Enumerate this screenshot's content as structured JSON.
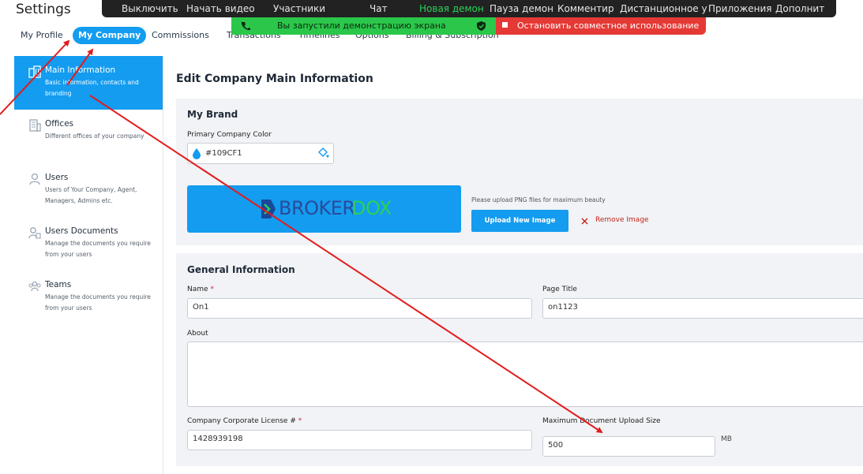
{
  "header": {
    "title": "Settings"
  },
  "tabs": [
    {
      "label": "My Profile"
    },
    {
      "label": "My Company"
    },
    {
      "label": "Commissions"
    },
    {
      "label": "Transactions"
    },
    {
      "label": "Timelines"
    },
    {
      "label": "Options"
    },
    {
      "label": "Billing & Subscription"
    }
  ],
  "sidebar": {
    "items": [
      {
        "title": "Main Information",
        "desc": "Basic information, contacts and branding",
        "icon": "building-icon"
      },
      {
        "title": "Offices",
        "desc": "Different offices of your company",
        "icon": "office-icon"
      },
      {
        "title": "Users",
        "desc": "Users of Your Company, Agent, Managers, Admins etc.",
        "icon": "user-icon"
      },
      {
        "title": "Users Documents",
        "desc": "Manage the documents you require from your users",
        "icon": "user-document-icon"
      },
      {
        "title": "Teams",
        "desc": "Manage the documents you require from your users",
        "icon": "teams-icon"
      }
    ]
  },
  "main": {
    "heading": "Edit Company Main Information",
    "brand": {
      "title": "My Brand",
      "color_label": "Primary Company Color",
      "color_value": "#109CF1",
      "logo_text_a": "BROKER",
      "logo_text_b": "DOX",
      "upload_hint": "Please upload PNG files for maximum beauty",
      "upload_label": "Upload New Image",
      "remove_label": "Remove Image"
    },
    "general": {
      "title": "General Information",
      "name_label": "Name",
      "name_value": "On1",
      "page_title_label": "Page Title",
      "page_title_value": "on1123",
      "about_label": "About",
      "about_value": "",
      "license_label": "Company Corporate License #",
      "license_value": "1428939198",
      "max_upload_label": "Maximum Document Upload Size",
      "max_upload_value": "500",
      "max_upload_unit": "MB"
    },
    "required_mark": "*"
  },
  "zoom_toolbar": {
    "items": [
      {
        "label": "Выключить"
      },
      {
        "label": "Начать видео"
      },
      {
        "label": "Участники"
      },
      {
        "label": "Чат"
      },
      {
        "label": "Новая демон"
      },
      {
        "label": "Пауза демон"
      },
      {
        "label": "Комментир"
      },
      {
        "label": "Дистанционное у"
      },
      {
        "label": "Приложения"
      },
      {
        "label": "Дополнит"
      }
    ],
    "sharing_text": "Вы запустили демонстрацию экрана",
    "stop_text": "Остановить совместное использование"
  },
  "colors": {
    "accent": "#139cf0",
    "primary_brand": "#109CF1",
    "annotation_arrow": "#e31b1b",
    "zoom_green": "#2bc74a",
    "zoom_red": "#e53935"
  }
}
